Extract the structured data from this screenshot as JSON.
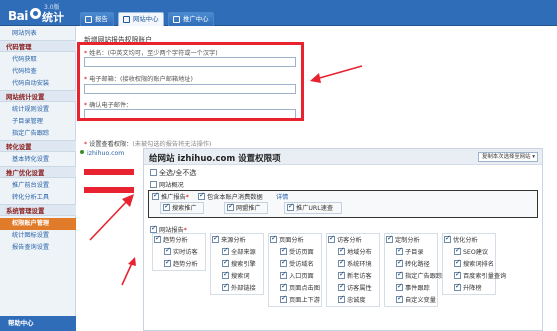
{
  "app": {
    "logo_text": "Bai",
    "logo_cn": "统计",
    "version": "3.0版"
  },
  "tabs": [
    {
      "label": "报告",
      "active": false
    },
    {
      "label": "网站中心",
      "active": true
    },
    {
      "label": "推广中心",
      "active": false
    }
  ],
  "sidebar": {
    "items": [
      {
        "type": "item",
        "label": "网站列表"
      },
      {
        "type": "head",
        "label": "代码管理"
      },
      {
        "type": "item",
        "label": "代码获取"
      },
      {
        "type": "item",
        "label": "代码检查"
      },
      {
        "type": "item",
        "label": "代码自动安装"
      },
      {
        "type": "head",
        "label": "网站统计设置"
      },
      {
        "type": "item",
        "label": "统计规则设置"
      },
      {
        "type": "item",
        "label": "子目录管理"
      },
      {
        "type": "item",
        "label": "指定广告跟踪"
      },
      {
        "type": "head",
        "label": "转化设置"
      },
      {
        "type": "item",
        "label": "基本转化设置"
      },
      {
        "type": "head",
        "label": "推广优化设置"
      },
      {
        "type": "item",
        "label": "推广前台设置"
      },
      {
        "type": "item",
        "label": "转化分析工具"
      },
      {
        "type": "head",
        "label": "系统管理设置"
      },
      {
        "type": "selected",
        "label": "权限账户管理"
      },
      {
        "type": "item",
        "label": "统计图标设置"
      },
      {
        "type": "item",
        "label": "报告查询设置"
      }
    ],
    "footer": "帮助中心"
  },
  "form": {
    "title": "新增网站报告权限账户",
    "name_label": "姓名：",
    "name_hint": "(中英文均可，至少两个字符或一个汉字)",
    "email_label": "电子邮箱：",
    "email_hint": "(接收权限的账户邮箱地址)",
    "email2_label": "确认电子邮件：",
    "star": "*"
  },
  "permissions": {
    "label": "设置查看权限：",
    "hint": "(未被勾选的报告将无法操作)",
    "sites": [
      {
        "name": "izhihuo.com"
      }
    ],
    "panel_title": "给网站 izhihuo.com 设置权限项",
    "copy_button": "复制本次选择至网站 ▾",
    "select_all": "全选/全不选",
    "overview": "网站概况",
    "promo_report": "推广报告",
    "include_cost": "包含本账户消费数据",
    "details_link": "详情",
    "promo_items": [
      "搜索推广",
      "网盟推广",
      "推广URL速查"
    ],
    "site_report": "网站报告",
    "site_columns": [
      {
        "head": "趋势分析",
        "items": [
          "实时访客",
          "趋势分析"
        ]
      },
      {
        "head": "来源分析",
        "items": [
          "全部来源",
          "搜索引擎",
          "搜索词",
          "外部链接"
        ]
      },
      {
        "head": "页面分析",
        "items": [
          "受访页面",
          "受访域名",
          "入口页面",
          "页面点击图",
          "页面上下游"
        ]
      },
      {
        "head": "访客分析",
        "items": [
          "地域分布",
          "系统环境",
          "新老访客",
          "访客属性",
          "忠诚度"
        ]
      },
      {
        "head": "定制分析",
        "items": [
          "子目录",
          "转化路径",
          "指定广告跟踪",
          "事件跟踪",
          "自定义变量"
        ]
      },
      {
        "head": "优化分析",
        "items": [
          "SEO建议",
          "搜索词排名",
          "百度索引量查询",
          "升降榜"
        ]
      }
    ]
  },
  "colors": {
    "header": "#2f6db8",
    "highlight_red": "#e8232f",
    "sidebar_selected": "#e07b2a"
  }
}
